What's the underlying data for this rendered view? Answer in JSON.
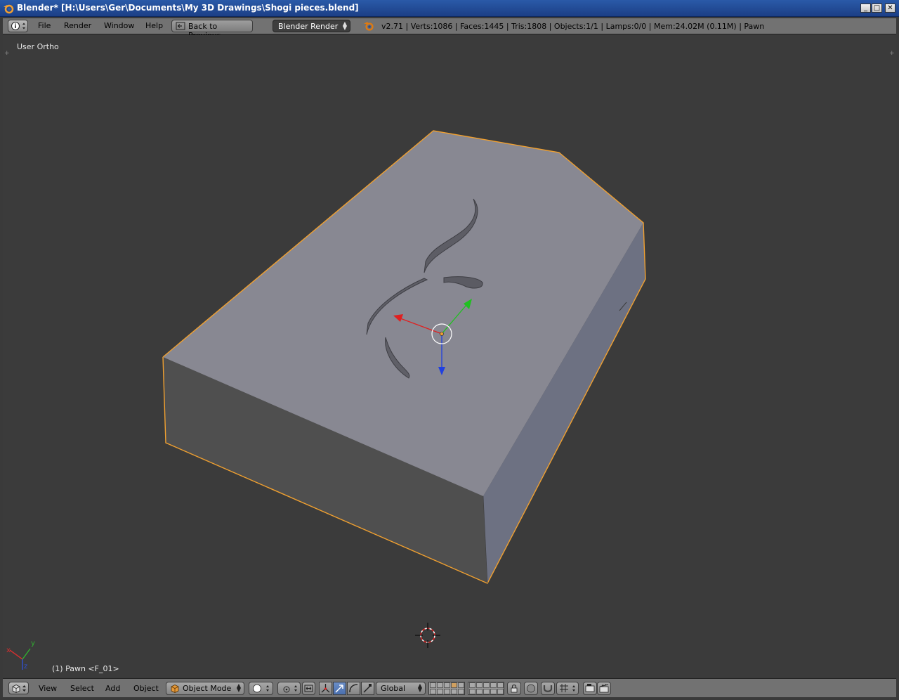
{
  "window": {
    "title": "Blender* [H:\\Users\\Ger\\Documents\\My 3D Drawings\\Shogi pieces.blend]",
    "minimize_symbol": "_",
    "maximize_symbol": "□",
    "close_symbol": "✕"
  },
  "header": {
    "editor_icon": "info-icon",
    "menus": [
      "File",
      "Render",
      "Window",
      "Help"
    ],
    "back_label": "Back to Previous",
    "render_engine": "Blender Render",
    "stats": "v2.71 | Verts:1086 | Faces:1445 | Tris:1808 | Objects:1/1 | Lamps:0/0 | Mem:24.02M (0.11M) | Pawn"
  },
  "viewport": {
    "view_name": "User Ortho",
    "object_info": "(1) Pawn <F_01>",
    "selection_color": "#f0a030",
    "axes": {
      "x": "x",
      "y": "y",
      "z": "z"
    }
  },
  "footer": {
    "editor_icon": "3d-view-icon",
    "menus": [
      "View",
      "Select",
      "Add",
      "Object"
    ],
    "mode": "Object Mode",
    "transform_orientation": "Global"
  },
  "colors": {
    "viewport_bg": "#3b3b3b",
    "header_bg": "#727272",
    "top_face": "#888892",
    "front_face": "#4f4f4f",
    "side_face": "#6d7182",
    "x_axis": "#e02020",
    "y_axis": "#20c020",
    "z_axis": "#2040e0"
  }
}
